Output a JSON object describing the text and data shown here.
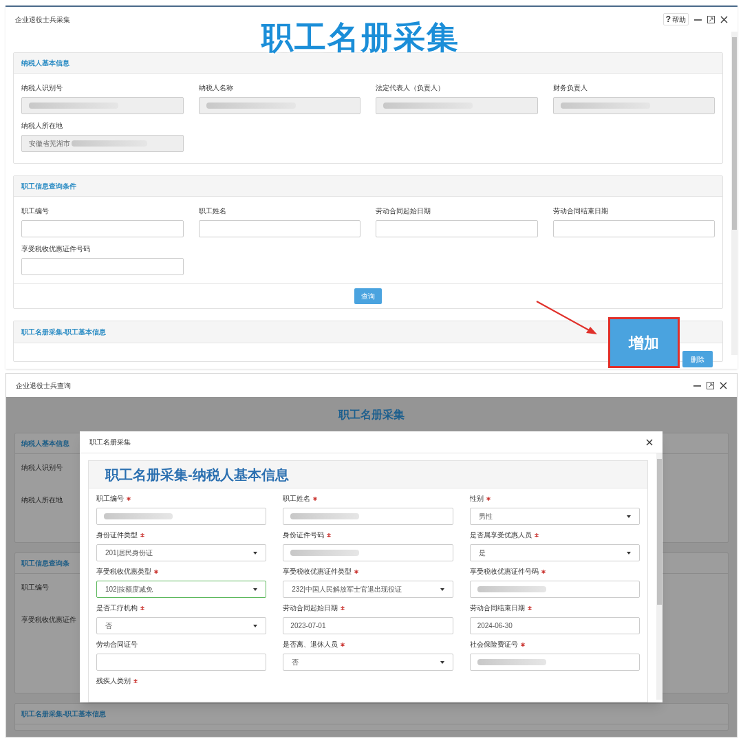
{
  "top_window": {
    "title": "企业退役士兵采集",
    "help_icon": "?",
    "help_label": "帮助",
    "overlay_title": "职工名册采集",
    "taxpayer_section": {
      "title": "纳税人基本信息",
      "fields": [
        {
          "label": "纳税人识别号",
          "redacted": true
        },
        {
          "label": "纳税人名称",
          "redacted": true
        },
        {
          "label": "法定代表人（负责人）",
          "redacted": true
        },
        {
          "label": "财务负责人",
          "redacted": true
        },
        {
          "label": "纳税人所在地",
          "value": "安徽省芜湖市",
          "redacted": true
        }
      ]
    },
    "query_section": {
      "title": "职工信息查询条件",
      "fields": [
        {
          "label": "职工编号"
        },
        {
          "label": "职工姓名"
        },
        {
          "label": "劳动合同起始日期"
        },
        {
          "label": "劳动合同结束日期"
        },
        {
          "label": "享受税收优惠证件号码"
        }
      ],
      "button": "查询"
    },
    "roster_section": {
      "title": "职工名册采集-职工基本信息",
      "add_button": "增加",
      "add_highlighted": true,
      "delete_button": "删除"
    }
  },
  "bottom_window": {
    "title": "企业退役士兵查询",
    "page_title": "职工名册采集",
    "background_sections": [
      {
        "title": "纳税人基本信息",
        "labels": [
          "纳税人识别号",
          "纳税人所在地"
        ]
      },
      {
        "title": "职工信息查询条",
        "labels": [
          "职工编号",
          "享受税收优惠证件"
        ]
      },
      {
        "title": "职工名册采集-职工基本信息"
      }
    ],
    "modal": {
      "title": "职工名册采集",
      "heading": "职工名册采集-纳税人基本信息",
      "fields": [
        {
          "label": "职工编号",
          "required": true,
          "kind": "text",
          "redacted": true,
          "focused": false
        },
        {
          "label": "职工姓名",
          "required": true,
          "kind": "text",
          "redacted": true,
          "focused": false
        },
        {
          "label": "性别",
          "required": true,
          "kind": "select",
          "value": "男性",
          "redacted": false,
          "focused": false
        },
        {
          "label": "身份证件类型",
          "required": true,
          "kind": "select",
          "value": "201|居民身份证",
          "redacted": false,
          "focused": false
        },
        {
          "label": "身份证件号码",
          "required": true,
          "kind": "text",
          "redacted": true,
          "focused": false
        },
        {
          "label": "是否属享受优惠人员",
          "required": true,
          "kind": "select",
          "value": "是",
          "redacted": false,
          "focused": false
        },
        {
          "label": "享受税收优惠类型",
          "required": true,
          "kind": "select",
          "value": "102|按额度减免",
          "redacted": false,
          "focused": true
        },
        {
          "label": "享受税收优惠证件类型",
          "required": true,
          "kind": "select",
          "value": "232|中国人民解放军士官退出现役证",
          "redacted": false,
          "focused": false
        },
        {
          "label": "享受税收优惠证件号码",
          "required": true,
          "kind": "text",
          "redacted": true,
          "focused": false
        },
        {
          "label": "是否工疗机构",
          "required": true,
          "kind": "select",
          "value": "否",
          "redacted": false,
          "focused": false
        },
        {
          "label": "劳动合同起始日期",
          "required": true,
          "kind": "text",
          "value": "2023-07-01",
          "redacted": false,
          "focused": false
        },
        {
          "label": "劳动合同结束日期",
          "required": true,
          "kind": "text",
          "value": "2024-06-30",
          "redacted": false,
          "focused": false
        },
        {
          "label": "劳动合同证号",
          "required": false,
          "kind": "text",
          "redacted": false,
          "focused": false
        },
        {
          "label": "是否离、退休人员",
          "required": true,
          "kind": "select",
          "value": "否",
          "redacted": false,
          "focused": false
        },
        {
          "label": "社会保险费证号",
          "required": true,
          "kind": "text",
          "redacted": true,
          "focused": false
        },
        {
          "label": "残疾人类别",
          "required": true,
          "kind": "label"
        }
      ]
    }
  }
}
